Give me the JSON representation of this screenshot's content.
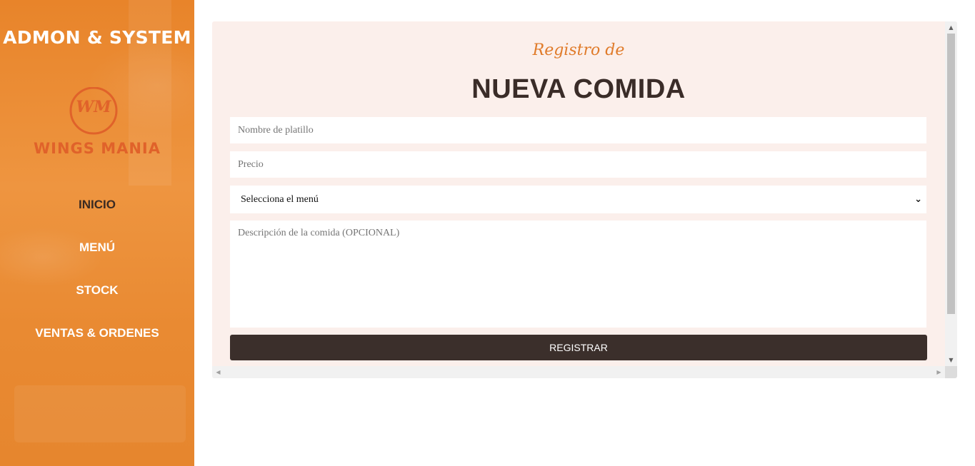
{
  "sidebar": {
    "brand": "ADMON & SYSTEM",
    "logo": {
      "monogram": "WM",
      "text": "WINGS MANIA",
      "color": "#e0622a"
    },
    "items": [
      {
        "label": "INICIO",
        "active": true
      },
      {
        "label": "MENÚ",
        "active": false
      },
      {
        "label": "STOCK",
        "active": false
      },
      {
        "label": "VENTAS & ORDENES",
        "active": false
      }
    ]
  },
  "form": {
    "subtitle": "Registro de",
    "title": "NUEVA COMIDA",
    "name_placeholder": "Nombre de platillo",
    "price_placeholder": "Precio",
    "menu_select": "Selecciona el menú",
    "description_placeholder": "Descripción de la comida (OPCIONAL)",
    "submit_label": "REGISTRAR"
  },
  "icons": {
    "select": "chevron-down-icon",
    "scroll_up": "arrow-up-icon",
    "scroll_down": "arrow-down-icon",
    "scroll_left": "arrow-left-icon",
    "scroll_right": "arrow-right-icon"
  },
  "colors": {
    "sidebar": "#ec8f3a",
    "accent": "#e07b2a",
    "panel": "#fbefeb",
    "button": "#3b2f2b",
    "text_dark": "#3a2c28"
  }
}
